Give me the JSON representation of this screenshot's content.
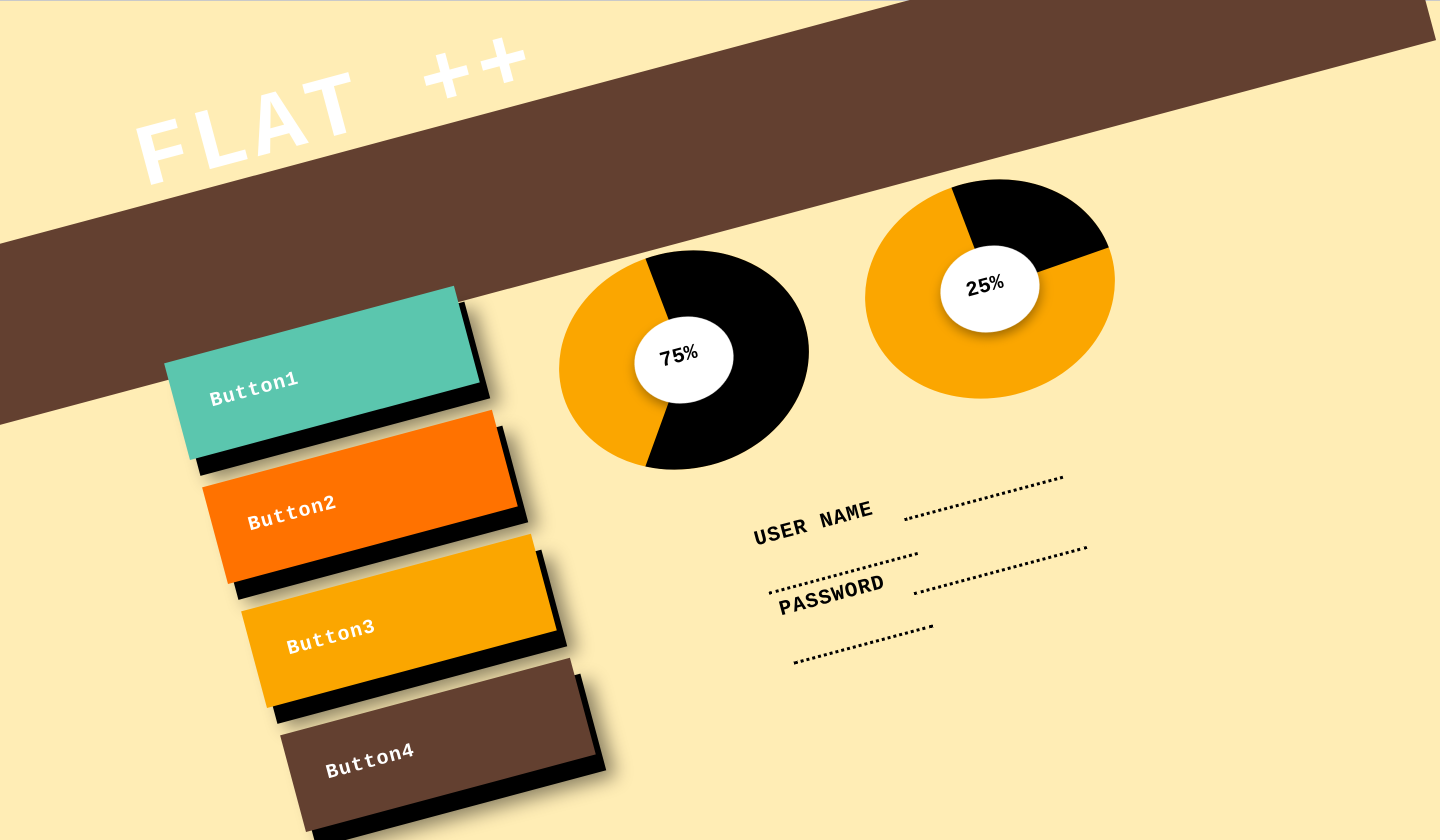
{
  "app": {
    "title": "FLAT ++"
  },
  "colors": {
    "background": "#ffedb5",
    "banner": "#634030",
    "button1": "#5bc6ae",
    "button2": "#ff7200",
    "button3": "#fba600",
    "button4": "#634030",
    "pie_accent": "#fba600",
    "pie_dark": "#000000"
  },
  "buttons": [
    {
      "label": "Button1"
    },
    {
      "label": "Button2"
    },
    {
      "label": "Button3"
    },
    {
      "label": "Button4"
    }
  ],
  "pies": [
    {
      "label": "75%",
      "value": 0.75
    },
    {
      "label": "25%",
      "value": 0.25
    }
  ],
  "form": {
    "username_label": "USER NAME",
    "username_value": "",
    "password_label": "PASSWORD",
    "password_value": ""
  }
}
